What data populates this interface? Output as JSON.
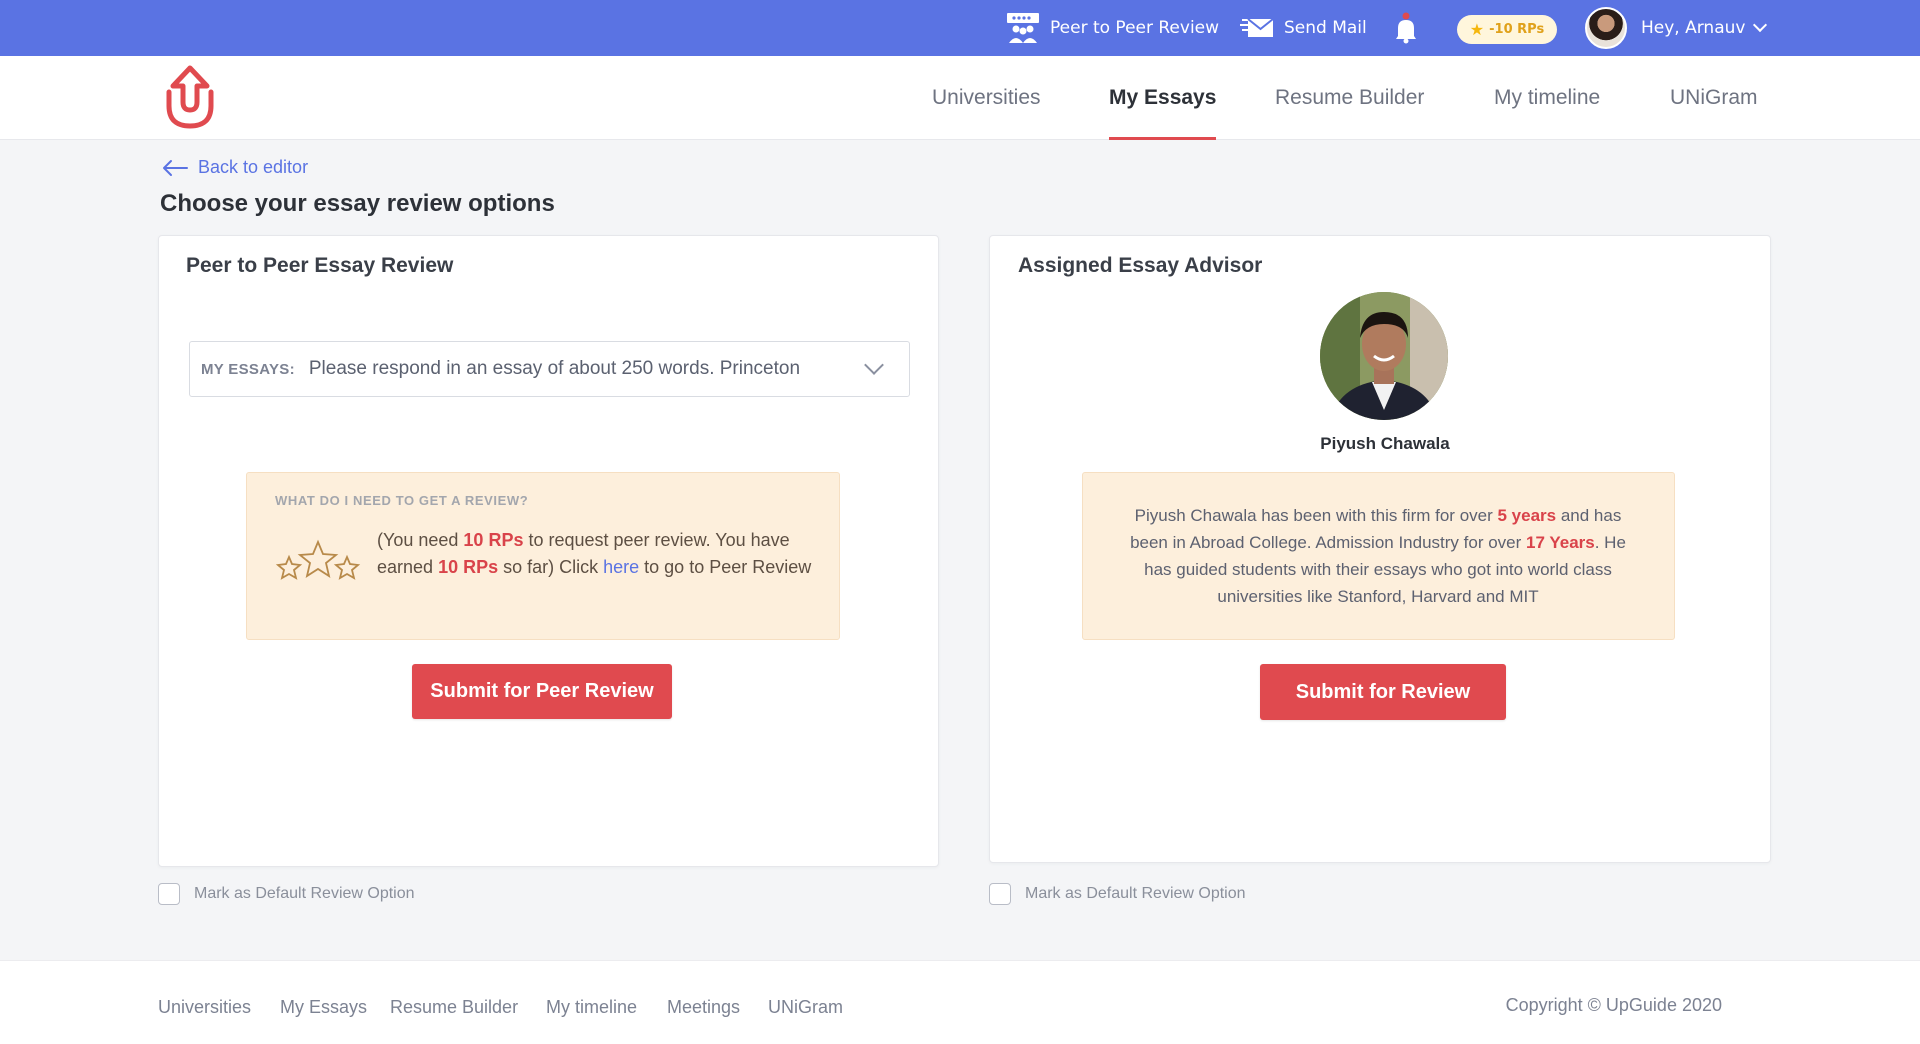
{
  "topbar": {
    "peer_review_label": "Peer to Peer Review",
    "send_mail_label": "Send Mail",
    "rp_badge": "-10 RPs",
    "greeting": "Hey, Arnauv"
  },
  "nav": {
    "items": [
      "Universities",
      "My Essays",
      "Resume Builder",
      "My timeline",
      "UNiGram"
    ],
    "active": "My Essays"
  },
  "back_label": "Back to editor",
  "page_title": "Choose your essay review options",
  "peer_card": {
    "title": "Peer to Peer Essay Review",
    "select_label": "MY ESSAYS:",
    "select_value": "Please respond in an essay of about 250 words. Princeton",
    "info_heading": "WHAT DO I NEED TO GET A REVIEW?",
    "info_t1": "(You need ",
    "info_req": "10 RPs",
    "info_t2": " to request peer review. You have earned ",
    "info_earned": "10 RPs",
    "info_t3": " so far) Click ",
    "info_link": "here",
    "info_t4": " to go to Peer Review",
    "button": "Submit for Peer Review",
    "default_option": "Mark as Default Review Option"
  },
  "advisor_card": {
    "title": "Assigned Essay Advisor",
    "name": "Piyush Chawala",
    "t1": "Piyush Chawala has been with this firm for over ",
    "years1": "5 years",
    "t2": " and has been in Abroad College. Admission Industry for over ",
    "years2": "17 Years",
    "t3": ". He has guided students with their essays who got into world class universities like Stanford, Harvard and MIT",
    "button": "Submit for Review",
    "default_option": "Mark as Default Review Option"
  },
  "footer": {
    "links": [
      "Universities",
      "My Essays",
      "Resume Builder",
      "My timeline",
      "Meetings",
      "UNiGram"
    ],
    "copyright": "Copyright © UpGuide 2020"
  },
  "colors": {
    "topbar": "#5a73e3",
    "accent_red": "#e04a4f",
    "info_bg": "#fdefdc"
  }
}
